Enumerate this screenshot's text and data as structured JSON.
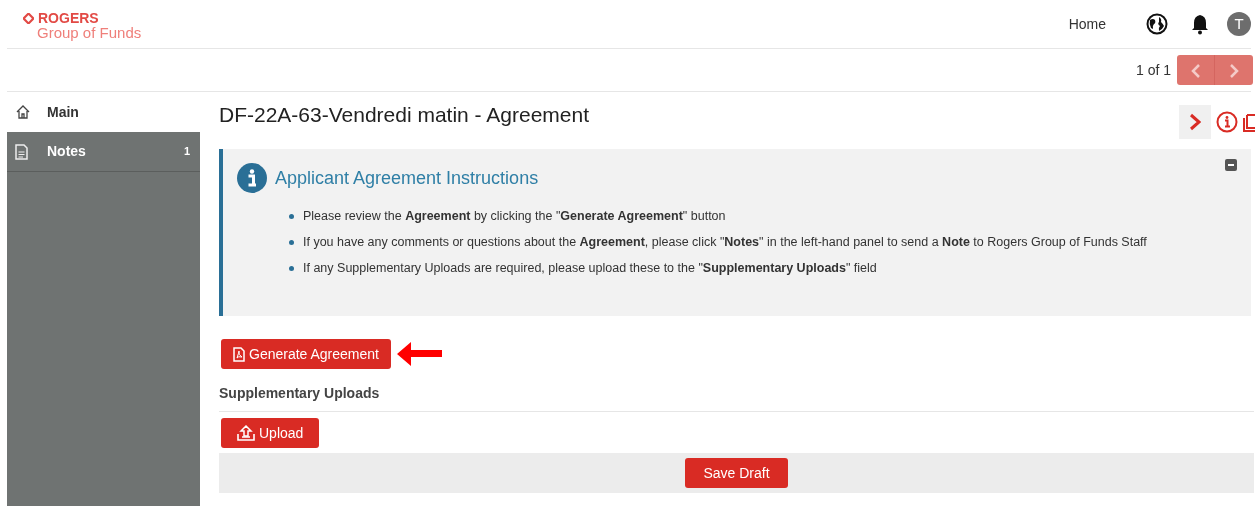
{
  "header": {
    "logo": {
      "brand": "ROGERS",
      "sub": "Group of Funds"
    },
    "nav_link": "Home",
    "avatar": "T"
  },
  "pager": {
    "text": "1 of 1",
    "prev_disabled": true,
    "next_disabled": true
  },
  "sidebar": {
    "items": [
      {
        "label": "Main",
        "selected": true
      },
      {
        "label": "Notes",
        "selected": false,
        "count": "1"
      }
    ]
  },
  "page_title": "DF-22A-63-Vendredi matin - Agreement",
  "instructions": {
    "title": "Applicant Agreement Instructions",
    "collapsed": false,
    "items": [
      "Please review the **Agreement** by clicking the \"**Generate Agreement**\" button",
      "If you have any comments or questions about the **Agreement**, please click \"**Notes**\" in the left-hand panel to send a **Note** to Rogers Group of Funds Staff",
      "If any Supplementary Uploads are required, please upload these to the \"**Supplementary Uploads**\" field"
    ]
  },
  "generate_button": "Generate Agreement",
  "supplementary": {
    "label": "Supplementary Uploads",
    "button": "Upload"
  },
  "save_button": "Save Draft"
}
